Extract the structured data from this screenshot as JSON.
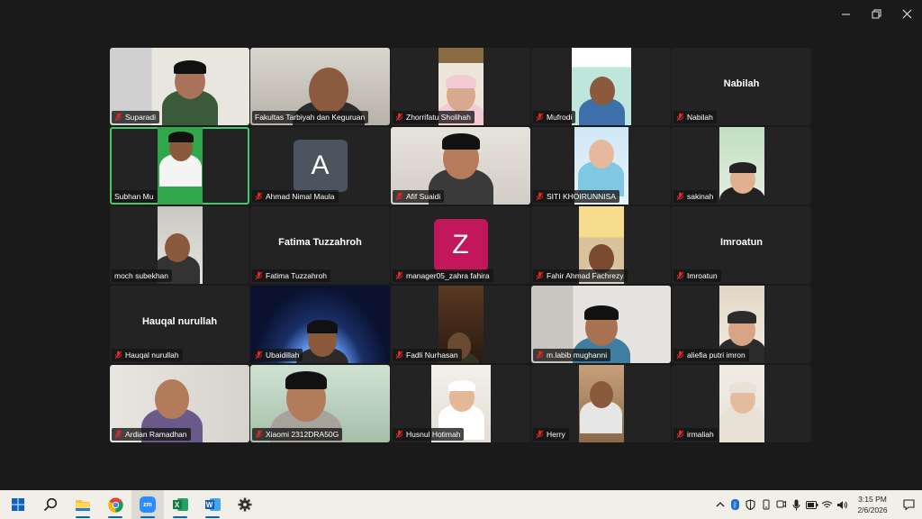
{
  "window": {
    "controls": [
      "minimize",
      "restore",
      "close"
    ]
  },
  "participants": [
    {
      "name": "Suparadi",
      "type": "video",
      "muted": true
    },
    {
      "name": "Fakultas Tarbiyah dan Keguruan",
      "type": "video",
      "muted": false
    },
    {
      "name": "Zhorrifatu Sholihah",
      "type": "video",
      "muted": true
    },
    {
      "name": "Mufrodi",
      "type": "video",
      "muted": true
    },
    {
      "name": "Nabilah",
      "type": "name",
      "display": "Nabilah",
      "muted": true
    },
    {
      "name": "Subhan Mu",
      "type": "video",
      "muted": false,
      "active_speaker": true
    },
    {
      "name": "Ahmad Nimal Maula",
      "type": "avatar",
      "letter": "A",
      "avatar_color": "#4a5560",
      "muted": true
    },
    {
      "name": "Afif Suaidi",
      "type": "video",
      "muted": true
    },
    {
      "name": "SITI KHOIRUNNISA",
      "type": "video",
      "muted": true
    },
    {
      "name": "sakinah",
      "type": "video",
      "muted": true
    },
    {
      "name": "moch subekhan",
      "type": "video",
      "muted": false
    },
    {
      "name": "Fatima Tuzzahroh",
      "type": "name",
      "display": "Fatima Tuzzahroh",
      "muted": true
    },
    {
      "name": "manager05_zahra fahira",
      "type": "avatar",
      "letter": "Z",
      "avatar_color": "#c2185b",
      "muted": true
    },
    {
      "name": "Fahir Ahmad Fachrezy",
      "type": "video",
      "muted": true
    },
    {
      "name": "Imroatun",
      "type": "name",
      "display": "Imroatun",
      "muted": true
    },
    {
      "name": "Hauqal nurullah",
      "type": "name",
      "display": "Hauqal nurullah",
      "muted": true
    },
    {
      "name": "Ubaidillah",
      "type": "video",
      "muted": true
    },
    {
      "name": "Fadli Nurhasan",
      "type": "video",
      "muted": true
    },
    {
      "name": "m.labib mughanni",
      "type": "video",
      "muted": true
    },
    {
      "name": "aliefia putri imron",
      "type": "video",
      "muted": true
    },
    {
      "name": "Ardian Ramadhan",
      "type": "video",
      "muted": true
    },
    {
      "name": "Xiaomi 2312DRA50G",
      "type": "video",
      "muted": true
    },
    {
      "name": "Husnul Hotimah",
      "type": "video",
      "muted": true
    },
    {
      "name": "Herry",
      "type": "video",
      "muted": true
    },
    {
      "name": "irmaliah",
      "type": "video",
      "muted": true
    }
  ],
  "taskbar": {
    "apps": [
      "windows-start",
      "search",
      "file-explorer",
      "chrome",
      "zoom",
      "excel",
      "word",
      "settings"
    ],
    "clock_time": "3:15 PM",
    "clock_date": "2/6/2026"
  },
  "colors": {
    "active_speaker": "#3ec96f",
    "mic_muted": "#e02828",
    "tile_bg": "#232323"
  }
}
